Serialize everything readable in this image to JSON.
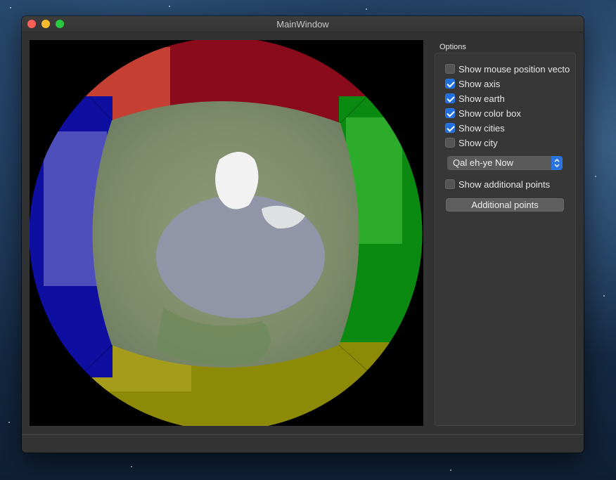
{
  "window": {
    "title": "MainWindow"
  },
  "options": {
    "group_title": "Options",
    "checkboxes": [
      {
        "label": "Show mouse position vecto",
        "checked": false
      },
      {
        "label": "Show axis",
        "checked": true
      },
      {
        "label": "Show earth",
        "checked": true
      },
      {
        "label": "Show color box",
        "checked": true
      },
      {
        "label": "Show cities",
        "checked": true
      },
      {
        "label": "Show city",
        "checked": false
      }
    ],
    "city_select": {
      "value": "Qal eh-ye Now"
    },
    "additional": {
      "label": "Show additional points",
      "checked": false
    },
    "button_label": "Additional points"
  },
  "colors": {
    "accent": "#1f6fe0",
    "face_top": "#8a0b1c",
    "face_right": "#0b8a12",
    "face_bottom": "#8c8a07",
    "face_left": "#0e0ea0"
  }
}
